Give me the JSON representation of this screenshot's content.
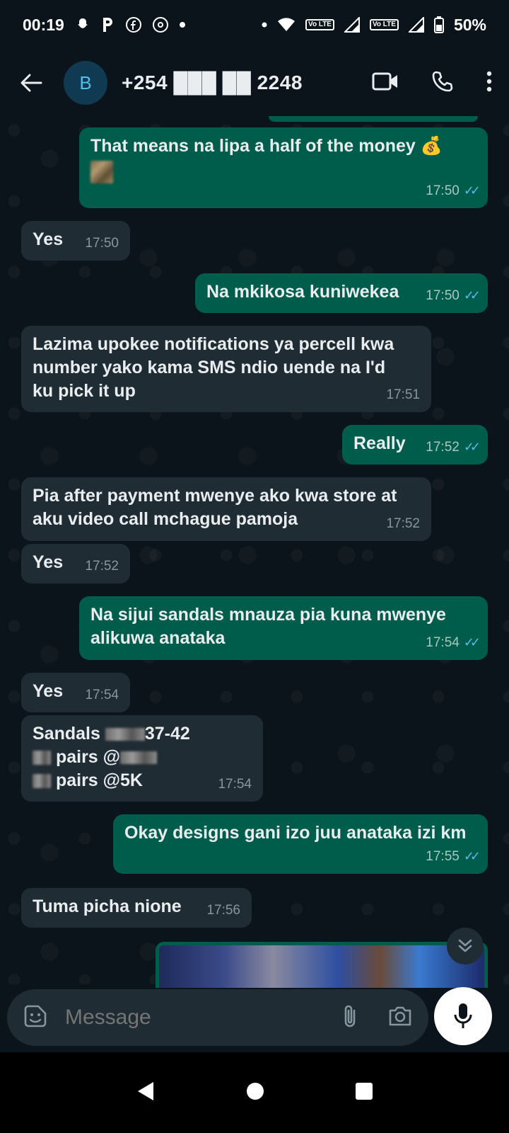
{
  "status_bar": {
    "time": "00:19",
    "battery": "50%",
    "volte_label": "Vo LTE"
  },
  "header": {
    "avatar_letter": "B",
    "contact_number": "+254 ███ ██ 2248"
  },
  "messages": [
    {
      "dir": "out",
      "text": "That means na lipa a half of the money 💰",
      "time": "17:50"
    },
    {
      "dir": "in",
      "text": "Yes",
      "time": "17:50"
    },
    {
      "dir": "out",
      "text": "Na mkikosa kuniwekea",
      "time": "17:50"
    },
    {
      "dir": "in",
      "text": "Lazima upokee notifications ya percell kwa number yako kama SMS ndio uende na I'd ku pick it up",
      "time": "17:51"
    },
    {
      "dir": "out",
      "text": "Really",
      "time": "17:52"
    },
    {
      "dir": "in",
      "text": "Pia after payment mwenye ako kwa store at aku video call mchague pamoja",
      "time": "17:52"
    },
    {
      "dir": "in",
      "text": "Yes",
      "time": "17:52"
    },
    {
      "dir": "out",
      "text": "Na sijui sandals mnauza pia kuna mwenye alikuwa anataka",
      "time": "17:54"
    },
    {
      "dir": "in",
      "text": "Yes",
      "time": "17:54"
    },
    {
      "dir": "in",
      "line1_a": "Sandals",
      "line1_b": "37-42",
      "line2": "pairs @",
      "line3": "pairs @5K",
      "time": "17:54"
    },
    {
      "dir": "out",
      "text": "Okay designs gani izo juu anataka izi km",
      "time": "17:55"
    },
    {
      "dir": "in",
      "text": "Tuma picha nione",
      "time": "17:56"
    }
  ],
  "composer": {
    "placeholder": "Message"
  },
  "colors": {
    "background": "#0b141a",
    "incoming_bubble": "#202c33",
    "outgoing_bubble": "#005c4b",
    "read_ticks": "#53bdeb"
  }
}
